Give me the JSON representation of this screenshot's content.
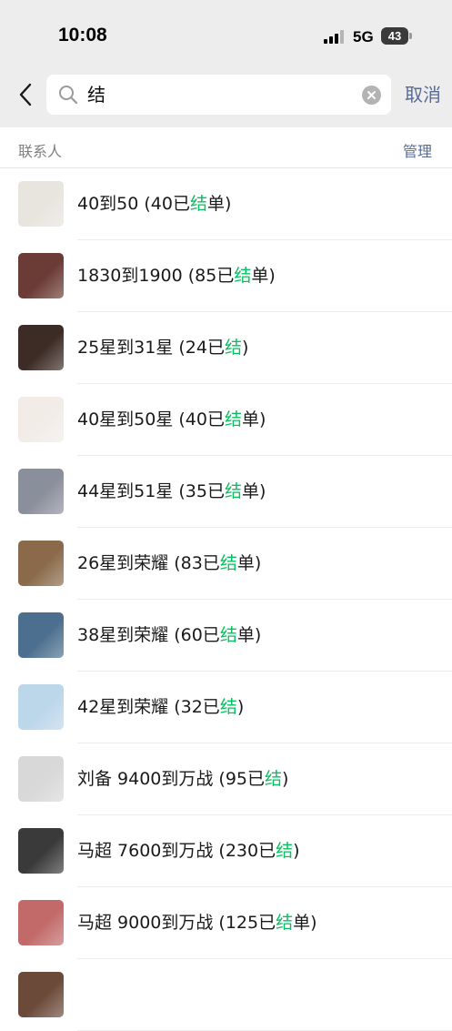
{
  "status_bar": {
    "time": "10:08",
    "network": "5G",
    "battery": "43"
  },
  "search": {
    "query": "结",
    "cancel_label": "取消"
  },
  "section": {
    "title": "联系人",
    "manage_label": "管理"
  },
  "contacts": [
    {
      "pre": "40到50 (40已",
      "hl": "结",
      "post": "单)",
      "avatar_color": "#e8e4de"
    },
    {
      "pre": "1830到1900 (85已",
      "hl": "结",
      "post": "单)",
      "avatar_color": "#6b3b35"
    },
    {
      "pre": "25星到31星 (24已",
      "hl": "结",
      "post": ")",
      "avatar_color": "#3d2c26"
    },
    {
      "pre": "40星到50星 (40已",
      "hl": "结",
      "post": "单)",
      "avatar_color": "#f1ece6"
    },
    {
      "pre": "44星到51星 (35已",
      "hl": "结",
      "post": "单)",
      "avatar_color": "#8a8f9c"
    },
    {
      "pre": "26星到荣耀 (83已",
      "hl": "结",
      "post": "单)",
      "avatar_color": "#8a6a4a"
    },
    {
      "pre": "38星到荣耀 (60已",
      "hl": "结",
      "post": "单)",
      "avatar_color": "#4c6f8f"
    },
    {
      "pre": "42星到荣耀 (32已",
      "hl": "结",
      "post": ")",
      "avatar_color": "#bcd6ea"
    },
    {
      "pre": "刘备 9400到万战 (95已",
      "hl": "结",
      "post": ")",
      "avatar_color": "#d8d8d8"
    },
    {
      "pre": "马超 7600到万战 (230已",
      "hl": "结",
      "post": ")",
      "avatar_color": "#3a3a3a"
    },
    {
      "pre": "马超 9000到万战 (125已",
      "hl": "结",
      "post": "单)",
      "avatar_color": "#c26a6a"
    },
    {
      "pre": "",
      "hl": "",
      "post": "",
      "avatar_color": "#6b4a3a"
    }
  ],
  "colors": {
    "accent_blue": "#576b95",
    "highlight_green": "#07c160"
  }
}
